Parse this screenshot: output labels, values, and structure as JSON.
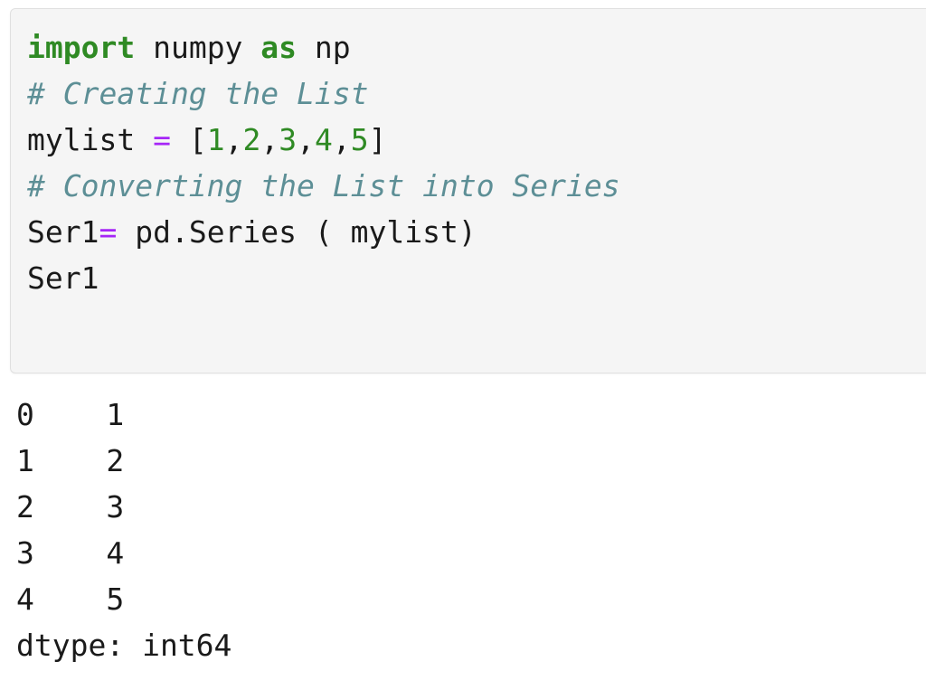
{
  "cell": {
    "kind": "jupyter-code-cell",
    "background_color": "#f5f5f5",
    "border_color": "#e0e0e0",
    "code_lines": [
      {
        "id": "line-1",
        "plain": "import numpy as np",
        "tokens": [
          {
            "t": "import",
            "k": "kw"
          },
          {
            "t": " numpy ",
            "k": "plain"
          },
          {
            "t": "as",
            "k": "kw"
          },
          {
            "t": " np",
            "k": "plain"
          }
        ]
      },
      {
        "id": "line-2",
        "plain": "# Creating the List",
        "tokens": [
          {
            "t": "# Creating the List",
            "k": "comment"
          }
        ]
      },
      {
        "id": "line-3",
        "plain": "mylist = [1,2,3,4,5]",
        "tokens": [
          {
            "t": "mylist ",
            "k": "plain"
          },
          {
            "t": "=",
            "k": "op"
          },
          {
            "t": " [",
            "k": "plain"
          },
          {
            "t": "1",
            "k": "num"
          },
          {
            "t": ",",
            "k": "plain"
          },
          {
            "t": "2",
            "k": "num"
          },
          {
            "t": ",",
            "k": "plain"
          },
          {
            "t": "3",
            "k": "num"
          },
          {
            "t": ",",
            "k": "plain"
          },
          {
            "t": "4",
            "k": "num"
          },
          {
            "t": ",",
            "k": "plain"
          },
          {
            "t": "5",
            "k": "num"
          },
          {
            "t": "]",
            "k": "plain"
          }
        ]
      },
      {
        "id": "line-4",
        "plain": "# Converting the List into Series",
        "tokens": [
          {
            "t": "# Converting the List into Series",
            "k": "comment"
          }
        ]
      },
      {
        "id": "line-5",
        "plain": "Ser1= pd.Series ( mylist)",
        "tokens": [
          {
            "t": "Ser1",
            "k": "plain"
          },
          {
            "t": "=",
            "k": "op"
          },
          {
            "t": " pd.Series ( mylist)",
            "k": "plain"
          }
        ]
      },
      {
        "id": "line-6",
        "plain": "Ser1",
        "tokens": [
          {
            "t": "Ser1",
            "k": "plain"
          }
        ]
      }
    ]
  },
  "output": {
    "kind": "pandas-series-repr",
    "rows": [
      {
        "index": "0",
        "value": "1"
      },
      {
        "index": "1",
        "value": "2"
      },
      {
        "index": "2",
        "value": "3"
      },
      {
        "index": "3",
        "value": "4"
      },
      {
        "index": "4",
        "value": "5"
      }
    ],
    "dtype_line": "dtype: int64",
    "lines": [
      "0    1",
      "1    2",
      "2    3",
      "3    4",
      "4    5",
      "dtype: int64"
    ]
  },
  "colors": {
    "keyword": "#2f8a24",
    "comment": "#5d8f96",
    "operator": "#a626f7",
    "number": "#2f8a24",
    "text": "#1a1a1a",
    "cell_bg": "#f5f5f5",
    "cell_border": "#e0e0e0",
    "page_bg": "#ffffff"
  }
}
